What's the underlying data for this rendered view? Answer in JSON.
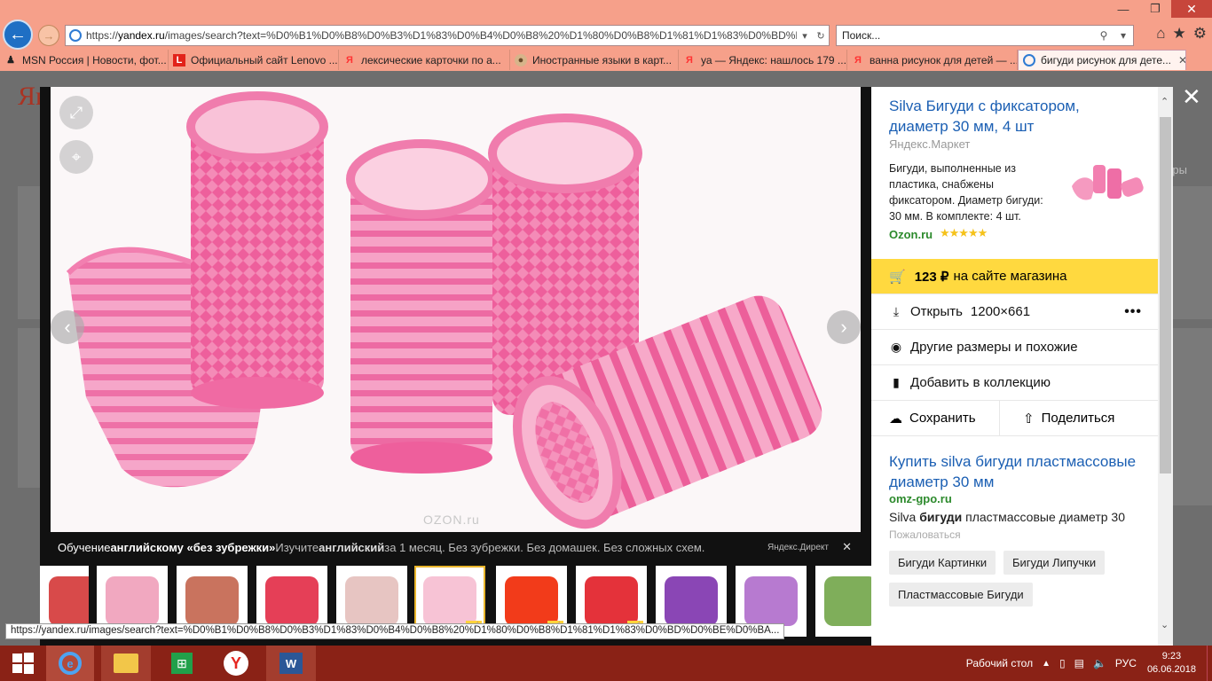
{
  "browser": {
    "url_prefix": "https://",
    "url_domain": "yandex.ru",
    "url_rest": "/images/search?text=%D0%B1%D0%B8%D0%B3%D1%83%D0%B4%D0%B8%20%D1%80%D0%B8%D1%81%D1%83%D0%BD%D0%BE%D0%BA%",
    "search_placeholder": "Поиск...",
    "tabs": [
      {
        "label": "MSN Россия | Новости, фот...",
        "icon": "msn-icon",
        "color": "#111"
      },
      {
        "label": "Официальный сайт Lenovo ...",
        "icon": "lenovo-icon",
        "color": "#e2231a"
      },
      {
        "label": "лексические карточки по а...",
        "icon": "yandex-icon",
        "color": "#f33"
      },
      {
        "label": "Иностранные языки в карт...",
        "icon": "dog-icon",
        "color": "#6a4a2a"
      },
      {
        "label": "уа — Яндекс: нашлось 179 ...",
        "icon": "yandex-icon",
        "color": "#f33"
      },
      {
        "label": "ванна рисунок для детей — ...",
        "icon": "yandex-icon",
        "color": "#f33"
      },
      {
        "label": "бигуди рисунок для дете...",
        "icon": "ie-icon",
        "color": "#2f7bd3"
      }
    ],
    "status_url": "https://yandex.ru/images/search?text=%D0%B1%D0%B8%D0%B3%D1%83%D0%B4%D0%B8%20%D1%80%D0%B8%D1%81%D1%83%D0%BD%D0%BE%D0%BA..."
  },
  "background": {
    "logo": "Ян",
    "filters_label": "тры"
  },
  "viewer": {
    "watermark": "OZON.ru",
    "ad": {
      "lead": "Обучение ",
      "lead_bold": "английскому «без зубрежки»",
      "text": " Изучите ",
      "text_bold": "английский",
      "text_rest": " за 1 месяц. Без зубрежки. Без домашек. Без сложных схем.",
      "source": "Яндекс.Директ"
    },
    "thumbnails": [
      {
        "color": "#d84a4a",
        "cart": false
      },
      {
        "color": "#f1a8c0",
        "cart": false
      },
      {
        "color": "#c9735e",
        "cart": false
      },
      {
        "color": "#e53f57",
        "cart": false
      },
      {
        "color": "#e7c5c2",
        "cart": false
      },
      {
        "color": "#f4a9c3",
        "cart": true,
        "selected": true
      },
      {
        "color": "#f23b1a",
        "cart": true
      },
      {
        "color": "#e4323a",
        "cart": true
      },
      {
        "color": "#8a46b5",
        "cart": false
      },
      {
        "color": "#b77ad0",
        "cart": false
      },
      {
        "color": "#7fae5a",
        "cart": false
      }
    ]
  },
  "panel": {
    "title": "Silva Бигуди с фиксатором, диаметр 30 мм, 4 шт",
    "source": "Яндекс.Маркет",
    "description": "Бигуди, выполненные из пластика, снабжены фиксатором. Диаметр бигуди: 30 мм. В комплекте: 4 шт.",
    "shop": "Ozon.ru",
    "rating": 5,
    "stars": "★★★★★",
    "price": "123 ₽",
    "price_note": "на сайте магазина",
    "open_label": "Открыть",
    "size": "1200×661",
    "similar_label": "Другие размеры и похожие",
    "collection_label": "Добавить в коллекцию",
    "save_label": "Сохранить",
    "share_label": "Поделиться",
    "ad2": {
      "title": "Купить silva бигуди пластмассовые диаметр 30 мм",
      "url": "omz-gpo.ru",
      "text_a": "Silva ",
      "text_b": "бигуди",
      "text_c": " пластмассовые диаметр 30",
      "note": "Пожаловаться"
    },
    "chips": [
      "Бигуди Картинки",
      "Бигуди Липучки",
      "Пластмассовые Бигуди"
    ]
  },
  "taskbar": {
    "desktop_label": "Рабочий стол",
    "lang": "РУС",
    "time": "9:23",
    "date": "06.06.2018"
  },
  "colors": {
    "accent_chrome": "#f6a08a",
    "taskbar": "#8a2216",
    "link": "#1b5fb3",
    "buy_yellow": "#ffd93f"
  }
}
